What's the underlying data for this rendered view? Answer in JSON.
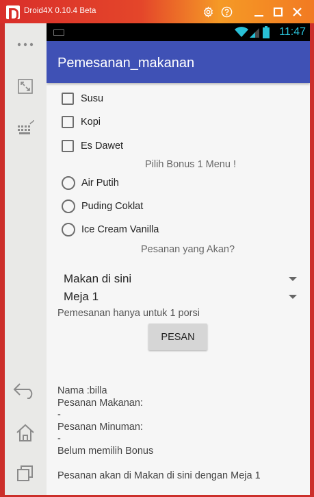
{
  "window": {
    "title": "Droid4X 0.10.4 Beta"
  },
  "statusbar": {
    "time": "11:47"
  },
  "app": {
    "title": "Pemesanan_makanan"
  },
  "drinks": [
    {
      "label": "Susu",
      "checked": false
    },
    {
      "label": "Kopi",
      "checked": false
    },
    {
      "label": "Es Dawet",
      "checked": false
    }
  ],
  "bonus": {
    "caption": "Pilih Bonus 1 Menu !",
    "options": [
      {
        "label": "Air Putih",
        "selected": false
      },
      {
        "label": "Puding Coklat",
        "selected": false
      },
      {
        "label": "Ice Cream Vanilla",
        "selected": false
      }
    ]
  },
  "order_caption": "Pesanan yang Akan?",
  "spinners": {
    "place": "Makan di sini",
    "table": "Meja 1"
  },
  "portion_note": "Pemesanan hanya untuk 1 porsi",
  "button": {
    "label": "PESAN"
  },
  "summary": {
    "name": "Nama :billa",
    "food_label": "Pesanan Makanan:",
    "food_value": "-",
    "drink_label": "Pesanan Minuman:",
    "drink_value": "-",
    "bonus": "Belum memilih Bonus",
    "final": "Pesanan akan di Makan di sini dengan Meja 1"
  },
  "colors": {
    "appbar": "#3f51b5",
    "window_accent": "#d92e2a",
    "status_time": "#29c0d7"
  },
  "icons": [
    "droid4x-logo-icon",
    "settings-icon",
    "help-icon",
    "minimize-icon",
    "maximize-icon",
    "close-icon",
    "more-icon",
    "fullscreen-icon",
    "keyboard-icon",
    "back-icon",
    "home-icon",
    "recents-icon",
    "wifi-icon",
    "signal-icon",
    "battery-icon"
  ]
}
